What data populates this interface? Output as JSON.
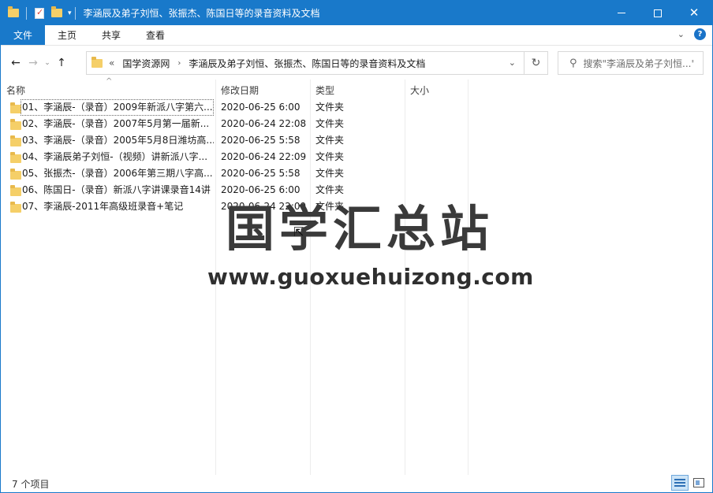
{
  "window": {
    "title": "李涵辰及弟子刘恒、张振杰、陈国日等的录音资料及文档"
  },
  "ribbon": {
    "tabs": [
      {
        "label": "文件"
      },
      {
        "label": "主页"
      },
      {
        "label": "共享"
      },
      {
        "label": "查看"
      }
    ]
  },
  "address": {
    "overflow": "«",
    "crumbs": [
      "国学资源网",
      "李涵辰及弟子刘恒、张振杰、陈国日等的录音资料及文档"
    ]
  },
  "search": {
    "placeholder": "搜索\"李涵辰及弟子刘恒...\""
  },
  "columns": {
    "name": "名称",
    "date": "修改日期",
    "type": "类型",
    "size": "大小"
  },
  "files": [
    {
      "name": "01、李涵辰-（录音）2009年新派八字第六...",
      "date": "2020-06-25 6:00",
      "type": "文件夹"
    },
    {
      "name": "02、李涵辰-（录音）2007年5月第一届新...",
      "date": "2020-06-24 22:08",
      "type": "文件夹"
    },
    {
      "name": "03、李涵辰-（录音）2005年5月8日潍坊高...",
      "date": "2020-06-25 5:58",
      "type": "文件夹"
    },
    {
      "name": "04、李涵辰弟子刘恒-（视频）讲新派八字...",
      "date": "2020-06-24 22:09",
      "type": "文件夹"
    },
    {
      "name": "05、张振杰-（录音）2006年第三期八字高...",
      "date": "2020-06-25 5:58",
      "type": "文件夹"
    },
    {
      "name": "06、陈国日-（录音）新派八字讲课录音14讲",
      "date": "2020-06-25 6:00",
      "type": "文件夹"
    },
    {
      "name": "07、李涵辰-2011年高级班录音+笔记",
      "date": "2020-06-24 22:09",
      "type": "文件夹"
    }
  ],
  "watermark": {
    "title": "国学汇总站",
    "url": "www.guoxuehuizong.com"
  },
  "status": {
    "item_count": "7 个项目"
  },
  "colors": {
    "accent": "#1979ca",
    "folder": "#f5cf68"
  }
}
